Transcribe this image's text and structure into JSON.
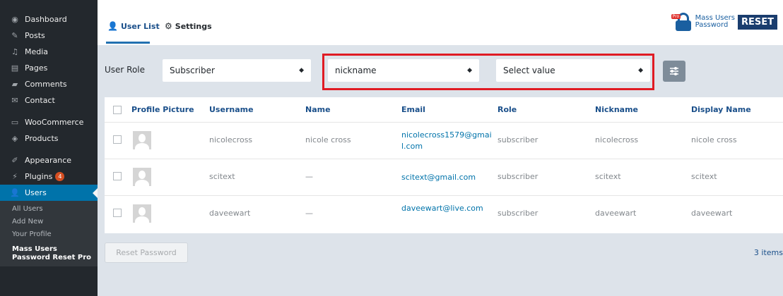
{
  "sidebar": {
    "items": [
      {
        "label": "Dashboard",
        "icon": "dashboard-icon"
      },
      {
        "label": "Posts",
        "icon": "pin-icon"
      },
      {
        "label": "Media",
        "icon": "media-icon"
      },
      {
        "label": "Pages",
        "icon": "pages-icon"
      },
      {
        "label": "Comments",
        "icon": "comments-icon"
      },
      {
        "label": "Contact",
        "icon": "mail-icon"
      },
      {
        "label": "WooCommerce",
        "icon": "woocommerce-icon"
      },
      {
        "label": "Products",
        "icon": "products-icon"
      },
      {
        "label": "Appearance",
        "icon": "brush-icon"
      },
      {
        "label": "Plugins",
        "icon": "plugin-icon",
        "badge": "4"
      },
      {
        "label": "Users",
        "icon": "users-icon"
      }
    ],
    "submenu": [
      "All Users",
      "Add New",
      "Your Profile"
    ],
    "current_sub": [
      "Mass Users",
      "Password Reset Pro"
    ]
  },
  "header": {
    "tabs": [
      {
        "label": "User List",
        "icon": "user-icon"
      },
      {
        "label": "Settings",
        "icon": "gear-icon"
      }
    ],
    "logo": {
      "badge": "Pro",
      "line1": "Mass Users",
      "line2": "Password",
      "reset": "RESET"
    }
  },
  "filters": {
    "label": "User Role",
    "role": "Subscriber",
    "field": "nickname",
    "value": "Select value"
  },
  "table": {
    "columns": [
      "Profile Picture",
      "Username",
      "Name",
      "Email",
      "Role",
      "Nickname",
      "Display Name"
    ],
    "rows": [
      {
        "username": "nicolecross",
        "name": "nicole cross",
        "email": "nicolecross1579@gmail.com",
        "role": "subscriber",
        "nickname": "nicolecross",
        "display": "nicole cross"
      },
      {
        "username": "scitext",
        "name": "—",
        "email": "scitext@gmail.com",
        "role": "subscriber",
        "nickname": "scitext",
        "display": "scitext"
      },
      {
        "username": "daveewart",
        "name": "—",
        "email": "daveewart@live.com",
        "role": "subscriber",
        "nickname": "daveewart",
        "display": "daveewart"
      }
    ]
  },
  "footer": {
    "reset_button": "Reset Password",
    "items_count": "3 items"
  },
  "colors": {
    "accent": "#0073aa",
    "highlight": "#e01b24",
    "sidebar": "#23282d"
  }
}
